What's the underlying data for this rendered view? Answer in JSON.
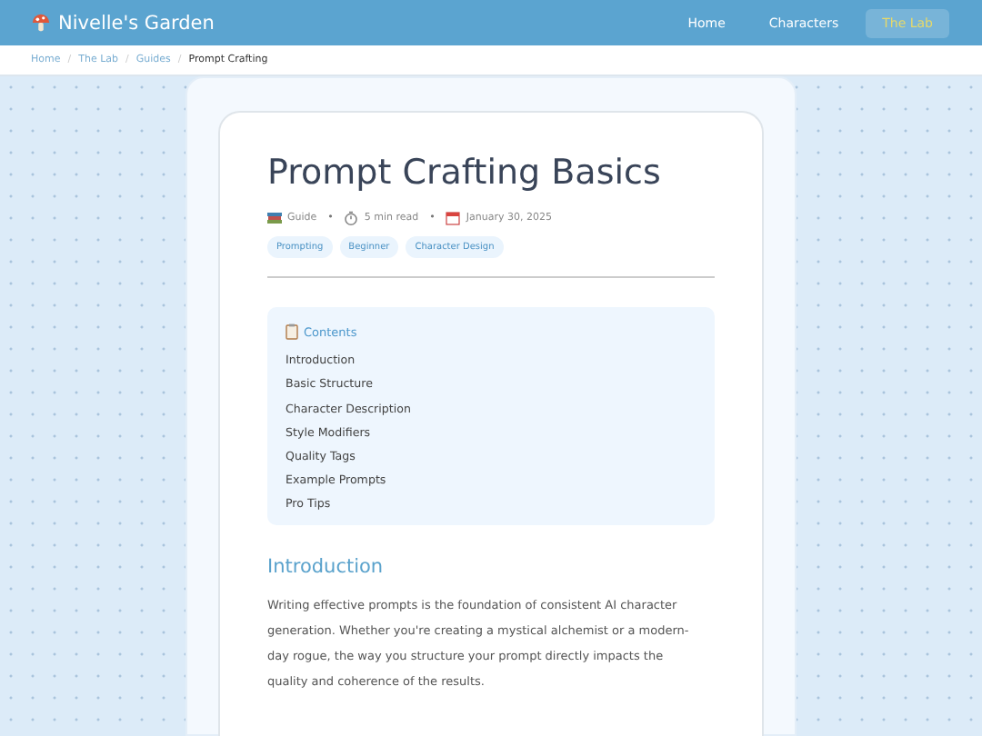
{
  "site": {
    "title": "Nivelle's Garden"
  },
  "nav": [
    {
      "label": "Home",
      "selected": false
    },
    {
      "label": "Characters",
      "selected": false
    },
    {
      "label": "The Lab",
      "selected": true
    }
  ],
  "breadcrumb": [
    {
      "label": "Home",
      "current": false
    },
    {
      "separator": "/",
      "label": "The Lab",
      "current": false
    },
    {
      "separator": "/",
      "label": "Guides",
      "current": false
    },
    {
      "separator": "/",
      "label": "Prompt Crafting",
      "current": true
    }
  ],
  "article": {
    "title": "Prompt Crafting Basics",
    "meta": [
      {
        "text": "Guide"
      },
      {
        "separator": "•",
        "text": "5 min read"
      },
      {
        "separator": "•",
        "text": "January 30, 2025"
      }
    ],
    "tags": [
      "Prompting",
      "Beginner",
      "Character Design"
    ],
    "contents": {
      "heading": "Contents",
      "items": [
        "Introduction",
        "Basic Structure",
        "Character Description",
        "Style Modifiers",
        "Quality Tags",
        "Example Prompts",
        "Pro Tips"
      ]
    },
    "section": {
      "heading": "Introduction",
      "text": "Writing effective prompts is the foundation of consistent AI character generation. Whether you're creating a mystical alchemist or a modern-day rogue, the way you structure your prompt directly impacts the quality and coherence of the results."
    }
  }
}
